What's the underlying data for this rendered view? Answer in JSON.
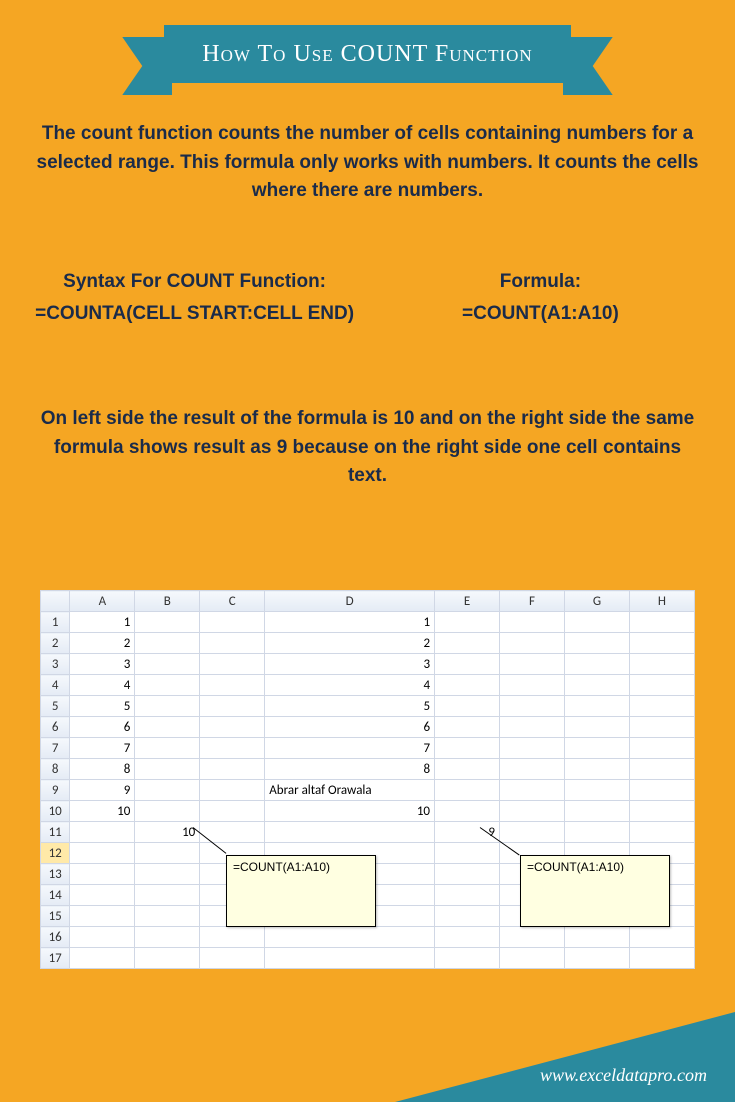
{
  "title": "How To Use COUNT Function",
  "description": "The count function counts the number of cells containing numbers for a selected range. This formula only works with numbers. It counts the cells where there are numbers.",
  "syntax_heading": "Syntax For COUNT Function:",
  "syntax_body": "=COUNTA(CELL START:CELL END)",
  "formula_heading": "Formula:",
  "formula_body": "=COUNT(A1:A10)",
  "explanation": "On left side the result of the formula is 10 and on the right side the same formula shows result as 9 because on the right side one cell contains text.",
  "sheet": {
    "columns": [
      "A",
      "B",
      "C",
      "D",
      "E",
      "F",
      "G",
      "H"
    ],
    "rows": [
      {
        "n": "1",
        "A": "1",
        "D": "1"
      },
      {
        "n": "2",
        "A": "2",
        "D": "2"
      },
      {
        "n": "3",
        "A": "3",
        "D": "3"
      },
      {
        "n": "4",
        "A": "4",
        "D": "4"
      },
      {
        "n": "5",
        "A": "5",
        "D": "5"
      },
      {
        "n": "6",
        "A": "6",
        "D": "6"
      },
      {
        "n": "7",
        "A": "7",
        "D": "7"
      },
      {
        "n": "8",
        "A": "8",
        "D": "8"
      },
      {
        "n": "9",
        "A": "9",
        "D": "Abrar altaf Orawala",
        "Dtext": true
      },
      {
        "n": "10",
        "A": "10",
        "D": "10"
      },
      {
        "n": "11",
        "B": "10",
        "E": "9"
      },
      {
        "n": "12"
      },
      {
        "n": "13"
      },
      {
        "n": "14"
      },
      {
        "n": "15"
      },
      {
        "n": "16"
      },
      {
        "n": "17"
      }
    ],
    "selected_row": 12
  },
  "callout_left": "=COUNT(A1:A10)",
  "callout_right": "=COUNT(A1:A10)",
  "footer_url": "www.exceldatapro.com",
  "chart_data": {
    "type": "table",
    "columns": [
      "A",
      "B",
      "C",
      "D",
      "E",
      "F",
      "G",
      "H"
    ],
    "data_A": [
      1,
      2,
      3,
      4,
      5,
      6,
      7,
      8,
      9,
      10
    ],
    "data_D": [
      1,
      2,
      3,
      4,
      5,
      6,
      7,
      8,
      "Abrar altaf Orawala",
      10
    ],
    "result_B11": 10,
    "result_E11": 9,
    "formula": "=COUNT(A1:A10)"
  }
}
